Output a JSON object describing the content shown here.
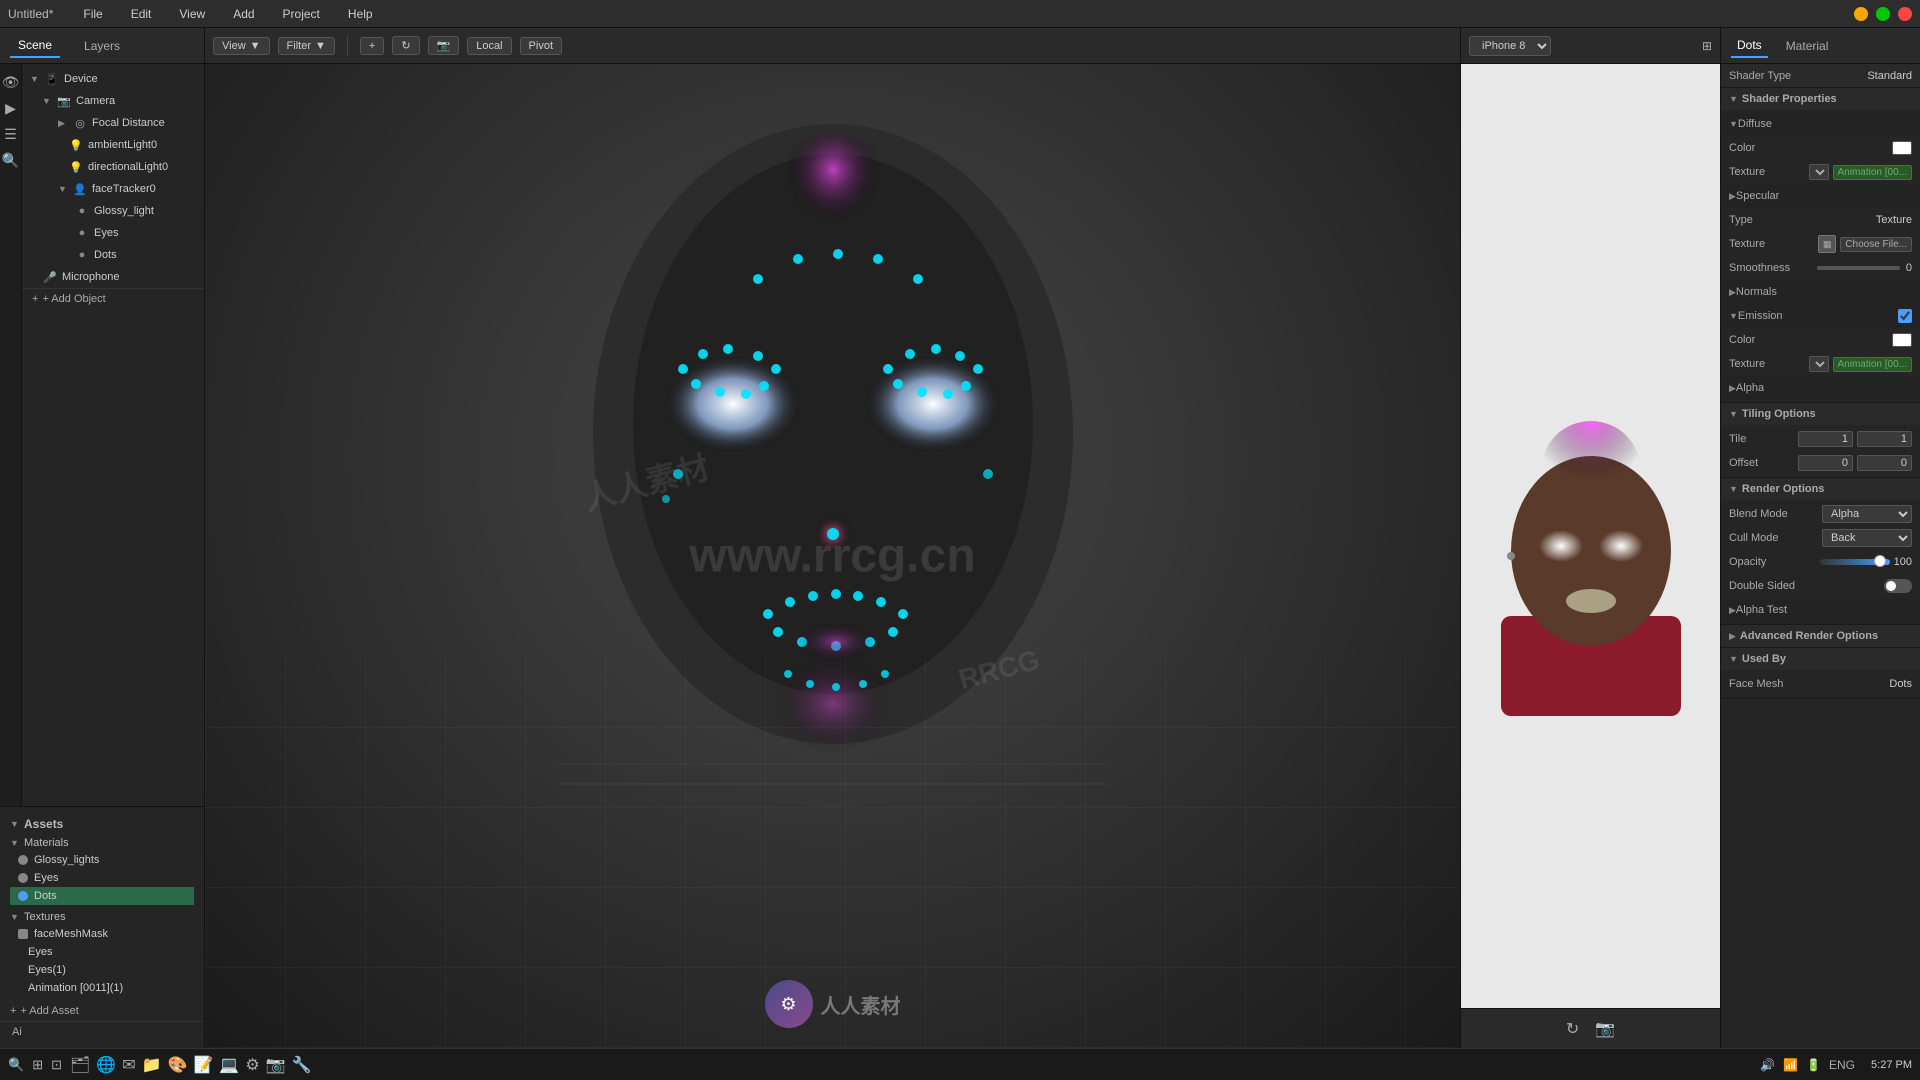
{
  "window": {
    "title": "Untitled*"
  },
  "menu": {
    "items": [
      "File",
      "Edit",
      "View",
      "Add",
      "Project",
      "Help"
    ]
  },
  "sidebar": {
    "scene_tab": "Scene",
    "layers_tab": "Layers",
    "tree": [
      {
        "label": "Device",
        "icon": "📱",
        "level": 0,
        "expanded": true
      },
      {
        "label": "Camera",
        "icon": "📷",
        "level": 1,
        "expanded": true
      },
      {
        "label": "Focal Distance",
        "icon": "◎",
        "level": 2,
        "expanded": false
      },
      {
        "label": "ambientLight0",
        "icon": "💡",
        "level": 3
      },
      {
        "label": "directionalLight0",
        "icon": "💡",
        "level": 3
      },
      {
        "label": "faceTracker0",
        "icon": "👤",
        "level": 3,
        "expanded": true
      },
      {
        "label": "Glossy_light",
        "icon": "●",
        "level": 4
      },
      {
        "label": "Eyes",
        "icon": "●",
        "level": 4
      },
      {
        "label": "Dots",
        "icon": "●",
        "level": 4
      },
      {
        "label": "Microphone",
        "icon": "🎤",
        "level": 2
      }
    ],
    "add_object_label": "+ Add Object",
    "assets_title": "Assets",
    "asset_groups": [
      {
        "name": "Materials",
        "items": [
          {
            "label": "Glossy_lights",
            "color": "#888"
          },
          {
            "label": "Eyes",
            "color": "#888"
          },
          {
            "label": "Dots",
            "color": "#4a9eff",
            "selected": true
          }
        ]
      },
      {
        "name": "Textures",
        "items": [
          {
            "label": "faceMeshMask",
            "color": "#888"
          },
          {
            "label": "Eyes",
            "color": "#888"
          },
          {
            "label": "Eyes(1)",
            "color": "#888"
          },
          {
            "label": "Animation [0011](1)",
            "color": "#888"
          }
        ]
      }
    ],
    "add_asset_label": "+ Add Asset",
    "ai_label": "Ai"
  },
  "viewport": {
    "view_label": "View",
    "filter_label": "Filter",
    "add_icon": "+",
    "refresh_icon": "↻",
    "local_label": "Local",
    "pivot_label": "Pivot",
    "device_select": "iPhone 8"
  },
  "right_panel": {
    "tabs": [
      "Dots",
      "Material"
    ],
    "shader_type_label": "Shader Type",
    "shader_type_value": "Standard",
    "sections": {
      "shader_properties": {
        "title": "Shader Properties",
        "diffuse": {
          "title": "Diffuse",
          "color_label": "Color",
          "texture_label": "Texture",
          "texture_anim": "Animation [00..."
        },
        "specular": {
          "title": "Specular",
          "type_label": "Type",
          "type_value": "Texture",
          "texture_label": "Texture",
          "smoothness_label": "Smoothness",
          "smoothness_value": "0"
        },
        "normals": {
          "title": "Normals"
        },
        "emission": {
          "title": "Emission",
          "color_label": "Color",
          "texture_label": "Texture",
          "texture_anim": "Animation [00..."
        },
        "alpha": {
          "title": "Alpha"
        }
      },
      "tiling_options": {
        "title": "Tiling Options",
        "tile_label": "Tile",
        "tile_x": "1",
        "tile_y": "1",
        "offset_label": "Offset",
        "offset_x": "0",
        "offset_y": "0"
      },
      "render_options": {
        "title": "Render Options",
        "blend_mode_label": "Blend Mode",
        "blend_mode_value": "Alpha",
        "cull_mode_label": "Cull Mode",
        "cull_mode_value": "Back",
        "opacity_label": "Opacity",
        "opacity_value": "100",
        "double_sided_label": "Double Sided",
        "alpha_test_label": "Alpha Test"
      },
      "advanced_render_options": {
        "title": "Advanced Render Options"
      },
      "used_by": {
        "title": "Used By",
        "face_mesh_label": "Face Mesh",
        "face_mesh_value": "Dots"
      }
    }
  },
  "taskbar": {
    "time": "5:27 PM",
    "lang": "ENG"
  }
}
